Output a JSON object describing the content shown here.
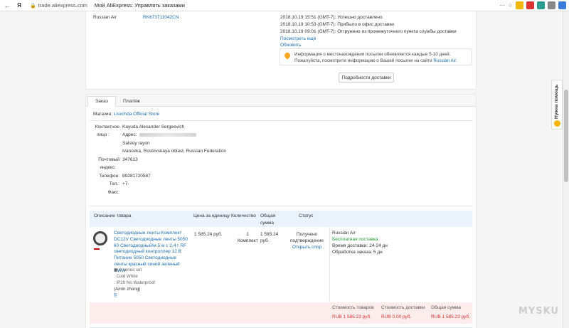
{
  "browser": {
    "back": "←",
    "ya": "Я",
    "url": "trade.aliexpress.com",
    "title": "Мой AliExpress: Управлять заказами",
    "ext_menu": "⋯",
    "ext_star": "☆"
  },
  "tracking": {
    "carrier": "Russian Air",
    "number": "RK673711042CN",
    "events": [
      "2018.10.19 15:51 (GMT-7): Успешно доставлено",
      "2018.10.19 10:53 (GMT-7): Прибыло в офис доставки",
      "2018.10.19 09:01 (GMT-7): Отгружено из промежуточного пункта службы доставки"
    ],
    "show_more": "Посмотреть ещё",
    "refresh": "Обновить",
    "info_text": "Информация о местонахождении посылки обновляется каждые 5-10 дней. Пожалуйста, посмотрите информацию о Вашей посылке на сайте",
    "info_link": "Russian Air.",
    "details_button": "Подробности доставки"
  },
  "tabs": [
    "Заказ",
    "Платёж"
  ],
  "store": {
    "label": "Магазин:",
    "name": "Lisxchda Official Store"
  },
  "address": {
    "contact_label_1": "Контактное",
    "contact_label_2": "лицо :",
    "contact_value": "Kayuda Alexander Sergeevich",
    "address_label": "Адрес:",
    "line_1": "Salskiy rayon",
    "line_2": "Ivanovka, Rostovskaya oblast, Russian Federation",
    "postal_label_1": "Почтовый",
    "postal_label_2": "индекс:",
    "postal_value": "347613",
    "phone_label": "Телефон:",
    "phone_value": "89281720587",
    "tel_label": "Тел.:",
    "tel_value": "+7-",
    "fax_label": "Факс:"
  },
  "table": {
    "headers": {
      "description": "Описание товара",
      "unit_price": "Цена за единицу",
      "quantity": "Количество",
      "total_1": "Общая",
      "total_2": "сумма",
      "status": "Статус"
    },
    "item": {
      "title": "Светодиодные ленты Комплект DC12V Светодиодные ленты 5050 60 Светодиодный/м 5 м с 2,4 г RF светодиодный контроллер 12 В Питание 5050 Светодиодные ленты красный синий зеленый CWW",
      "attr_1": "A series set",
      "attr_2": "Cold White",
      "attr_3": "IP20 No Waterproof",
      "seller": "(Amin zhong)",
      "unit_price": "1 585.24 руб.",
      "qty_1": "1",
      "qty_2": "Комплект",
      "total_1": "1 585.24",
      "total_2": "руб.",
      "status_1": "Получено",
      "status_2": "подтверждение",
      "dispute": "Открыть спор",
      "ship_carrier": "Russian Air",
      "ship_free": "Бесплатная поставка",
      "ship_time": "Время доставки: 24-24 дн",
      "processing": "Обработка заказа: 5 дн"
    }
  },
  "totals": {
    "goods_label": "Стоимость товаров",
    "goods_value": "RUB 1 585.23 руб.",
    "shipping_label": "Стоимость доставки",
    "shipping_value": "RUB 0.00 руб.",
    "total_label": "Общая сумма",
    "total_value": "RUB 1 585.23 руб."
  },
  "help_widget": "Нужна помощь",
  "watermark": "MYSKU"
}
